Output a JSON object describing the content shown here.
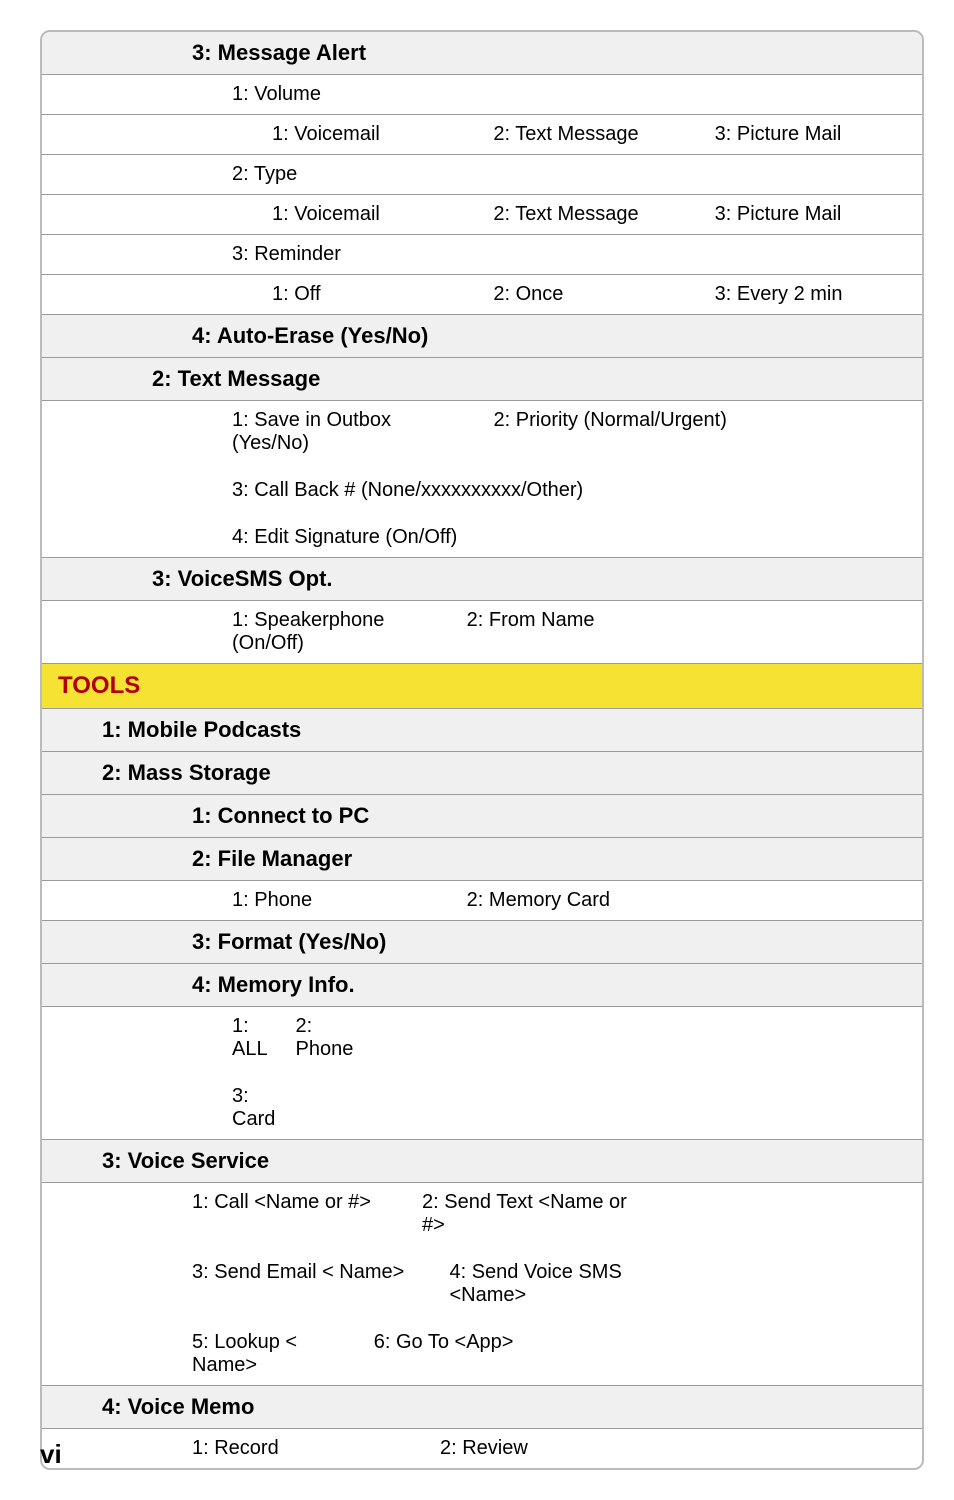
{
  "page_number": "vi",
  "sections": {
    "msgAlert": {
      "header": "3: Message Alert",
      "volume": {
        "header": "1: Volume",
        "c1": "1: Voicemail",
        "c2": "2: Text Message",
        "c3": "3: Picture Mail"
      },
      "type": {
        "header": "2: Type",
        "c1": "1: Voicemail",
        "c2": "2: Text Message",
        "c3": "3: Picture Mail"
      },
      "reminder": {
        "header": "3: Reminder",
        "c1": "1: Off",
        "c2": "2: Once",
        "c3": "3: Every 2 min"
      },
      "autoErase": "4: Auto-Erase (Yes/No)"
    },
    "textMessage": {
      "header": "2: Text Message",
      "l1": "1: Save in Outbox (Yes/No)",
      "r1": "2: Priority (Normal/Urgent)",
      "l2": "3: Call Back # (None/xxxxxxxxxx/Other)",
      "l3": "4: Edit Signature (On/Off)"
    },
    "voiceSmsOpt": {
      "header": "3: VoiceSMS Opt.",
      "c1": "1: Speakerphone (On/Off)",
      "c2": "2: From Name"
    },
    "tools": {
      "header": "TOOLS",
      "mobilePodcasts": "1: Mobile Podcasts",
      "massStorage": {
        "header": "2: Mass Storage",
        "connect": "1: Connect to PC",
        "fileManager": {
          "header": "2: File Manager",
          "c1": "1: Phone",
          "c2": "2: Memory Card"
        },
        "format": "3: Format (Yes/No)",
        "memoryInfo": {
          "header": "4: Memory Info.",
          "l1": "1: ALL",
          "r1": "2: Phone",
          "l2": "3: Card"
        }
      },
      "voiceService": {
        "header": "3: Voice Service",
        "l1": "1: Call <Name or #>",
        "r1": "2: Send Text <Name or #>",
        "l2": "3: Send Email < Name>",
        "r2": "4: Send Voice SMS <Name>",
        "l3": "5: Lookup < Name>",
        "r3": "6: Go To <App>"
      },
      "voiceMemo": {
        "header": "4: Voice Memo",
        "c1": "1: Record",
        "c2": "2: Review"
      }
    }
  }
}
